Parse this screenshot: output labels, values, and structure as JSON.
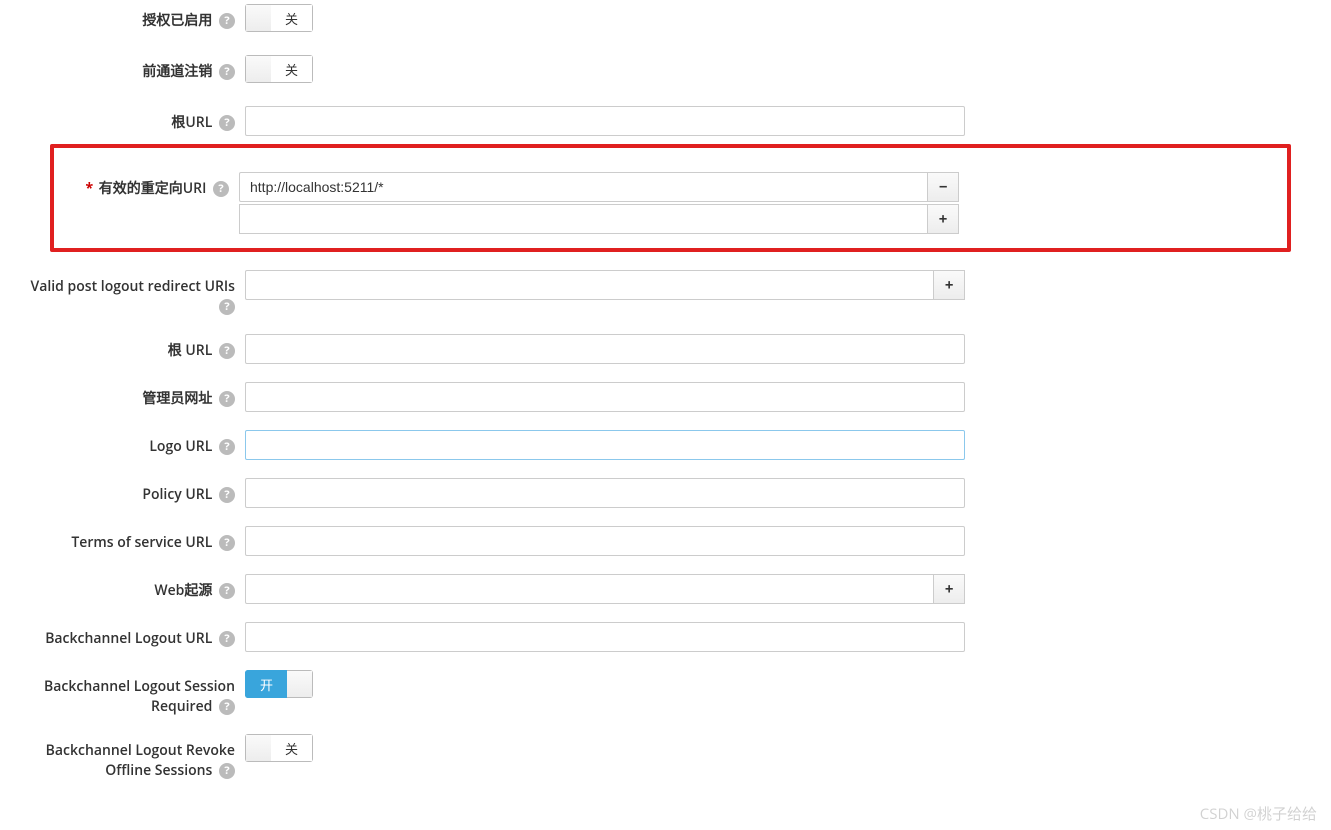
{
  "toggle": {
    "off": "关",
    "on": "开"
  },
  "fields": {
    "auth_enabled": {
      "label": "授权已启用"
    },
    "front_channel_logout": {
      "label": "前通道注销"
    },
    "root_url_top": {
      "label": "根URL",
      "value": ""
    },
    "valid_redirect": {
      "label": "有效的重定向URI",
      "value": "http://localhost:5211/*"
    },
    "valid_post_logout": {
      "label": "Valid post logout redirect URIs",
      "value": ""
    },
    "root_url": {
      "label": "根 URL",
      "value": ""
    },
    "admin_url": {
      "label": "管理员网址",
      "value": ""
    },
    "logo_url": {
      "label": "Logo URL",
      "value": ""
    },
    "policy_url": {
      "label": "Policy URL",
      "value": ""
    },
    "tos_url": {
      "label": "Terms of service URL",
      "value": ""
    },
    "web_origins": {
      "label": "Web起源",
      "value": ""
    },
    "bc_logout_url": {
      "label": "Backchannel Logout URL",
      "value": ""
    },
    "bc_logout_session": {
      "label": "Backchannel Logout Session Required"
    },
    "bc_logout_revoke": {
      "label": "Backchannel Logout Revoke Offline Sessions"
    }
  },
  "watermark": "CSDN @桃子给给"
}
